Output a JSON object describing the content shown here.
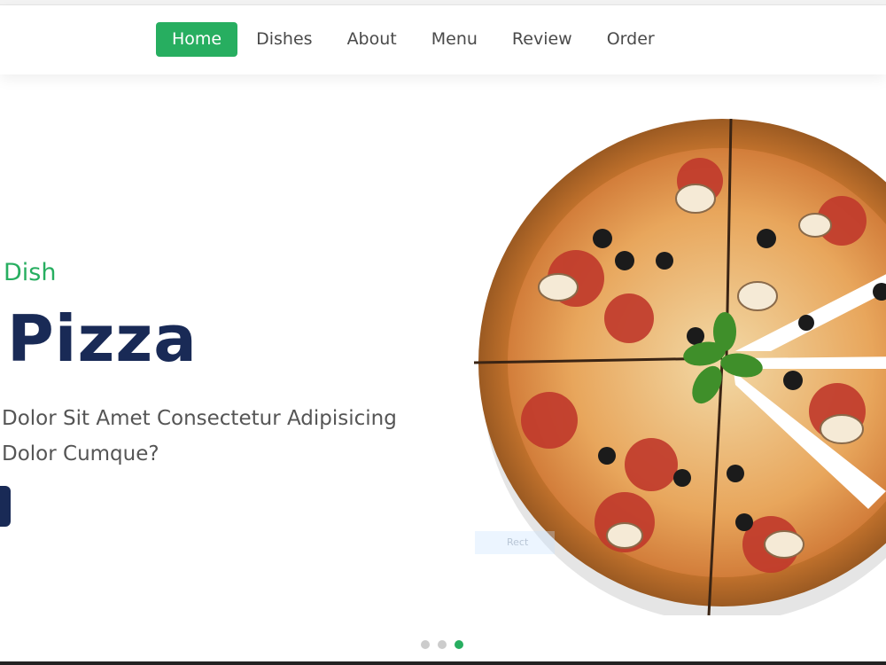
{
  "nav": {
    "items": [
      {
        "label": "Home",
        "active": true
      },
      {
        "label": "Dishes",
        "active": false
      },
      {
        "label": "About",
        "active": false
      },
      {
        "label": "Menu",
        "active": false
      },
      {
        "label": "Review",
        "active": false
      },
      {
        "label": "Order",
        "active": false
      }
    ]
  },
  "hero": {
    "subtitle": "Dish",
    "title": "Pizza",
    "description": "Dolor Sit Amet Consectetur Adipisicing Dolor Cumque?",
    "image": "pizza-image",
    "ghost_label": "Rect"
  },
  "slider": {
    "dots": 3,
    "active_index": 2
  },
  "colors": {
    "accent": "#27ae60",
    "primary": "#192a56",
    "text": "#4a4a4a"
  }
}
